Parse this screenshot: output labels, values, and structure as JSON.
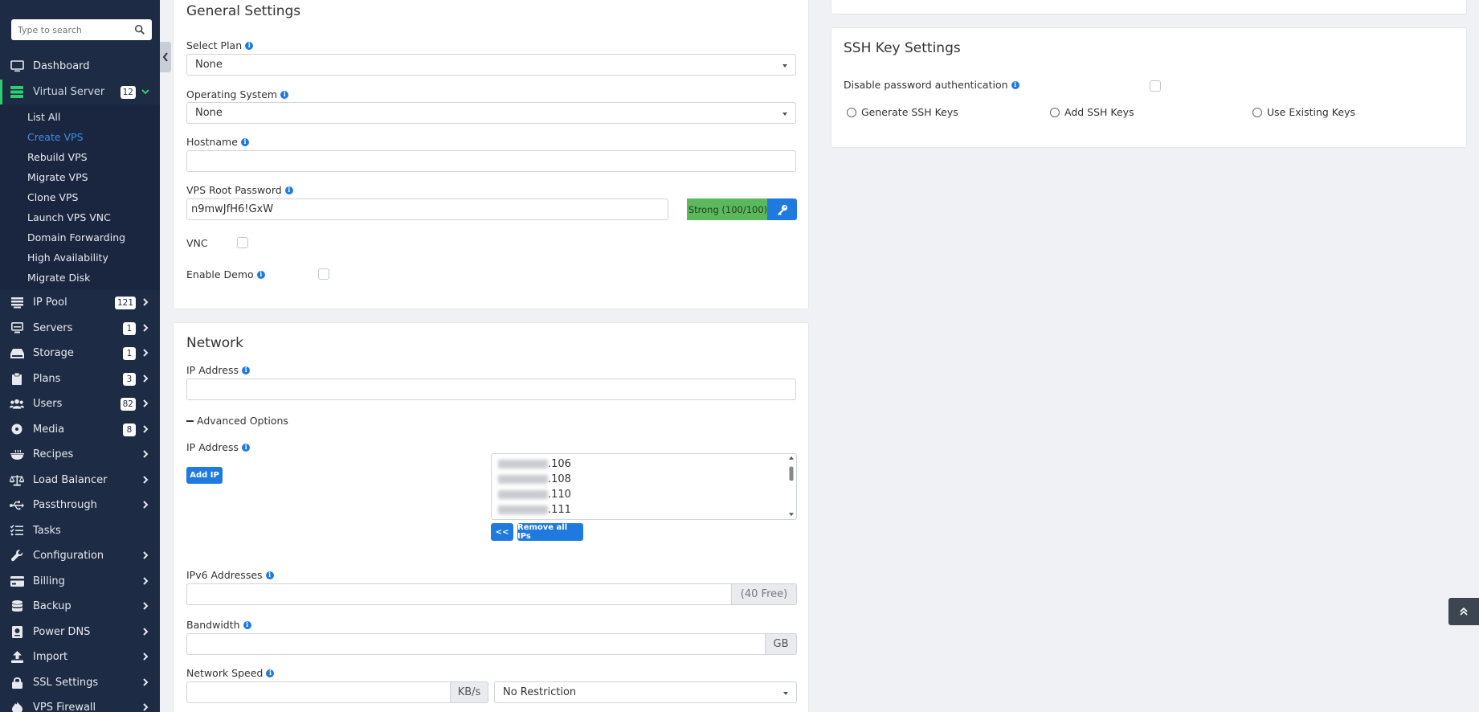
{
  "search": {
    "placeholder": "Type to search"
  },
  "nav": {
    "dashboard": "Dashboard",
    "virtual_server": {
      "label": "Virtual Server",
      "badge": "12"
    },
    "sub_items": [
      "List All",
      "Create VPS",
      "Rebuild VPS",
      "Migrate VPS",
      "Clone VPS",
      "Launch VPS VNC",
      "Domain Forwarding",
      "High Availability",
      "Migrate Disk"
    ],
    "ip_pool": {
      "label": "IP Pool",
      "badge": "121"
    },
    "servers": {
      "label": "Servers",
      "badge": "1"
    },
    "storage": {
      "label": "Storage",
      "badge": "1"
    },
    "plans": {
      "label": "Plans",
      "badge": "3"
    },
    "users": {
      "label": "Users",
      "badge": "82"
    },
    "media": {
      "label": "Media",
      "badge": "8"
    },
    "recipes": "Recipes",
    "load_balancer": "Load Balancer",
    "passthrough": "Passthrough",
    "tasks": "Tasks",
    "configuration": "Configuration",
    "billing": "Billing",
    "backup": "Backup",
    "power_dns": "Power DNS",
    "import": "Import",
    "ssl_settings": "SSL Settings",
    "vps_firewall": "VPS Firewall"
  },
  "general": {
    "title": "General Settings",
    "select_plan_label": "Select Plan",
    "select_plan_value": "None",
    "os_label": "Operating System",
    "os_value": "None",
    "hostname_label": "Hostname",
    "hostname_value": "",
    "root_pw_label": "VPS Root Password",
    "root_pw_value": "n9mwJfH6!GxW",
    "strength": "Strong (100/100)",
    "vnc_label": "VNC",
    "demo_label": "Enable Demo"
  },
  "network": {
    "title": "Network",
    "ip_label": "IP Address",
    "advanced_label": "Advanced Options",
    "ip_label2": "IP Address",
    "add_ip": "Add IP",
    "ip_suffixes": [
      ".106",
      ".108",
      ".110",
      ".111"
    ],
    "move_left": "<<",
    "remove_all": "Remove all IPs",
    "ipv6_label": "IPv6 Addresses",
    "ipv6_free": "(40 Free)",
    "bandwidth_label": "Bandwidth",
    "bandwidth_unit": "GB",
    "speed_label": "Network Speed",
    "speed_unit": "KB/s",
    "speed_restriction": "No Restriction"
  },
  "ssh": {
    "title": "SSH Key Settings",
    "disable_pw_label": "Disable password authentication",
    "options": [
      "Generate SSH Keys",
      "Add SSH Keys",
      "Use Existing Keys"
    ]
  },
  "colors": {
    "sidebar": "#1e2b44",
    "accent": "#1f7ae0",
    "active": "#2ecc71",
    "strength": "#5cb85c"
  }
}
